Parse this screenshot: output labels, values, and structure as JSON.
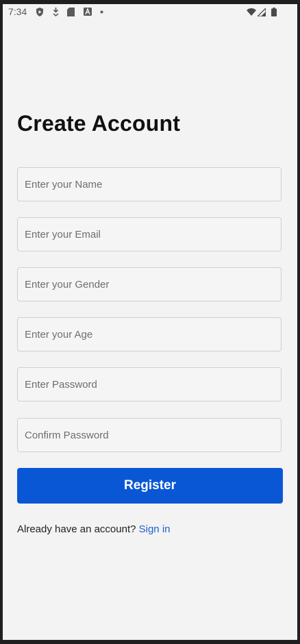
{
  "status_bar": {
    "time": "7:34",
    "left_icons": [
      "play-protect-icon",
      "download-icon",
      "sd-card-icon",
      "a-icon",
      "dot-icon"
    ],
    "right_icons": [
      "wifi-icon",
      "signal-icon",
      "battery-icon"
    ]
  },
  "page": {
    "title": "Create Account"
  },
  "form": {
    "name_placeholder": "Enter your Name",
    "email_placeholder": "Enter your Email",
    "gender_placeholder": "Enter your Gender",
    "age_placeholder": "Enter your Age",
    "password_placeholder": "Enter Password",
    "confirm_placeholder": "Confirm Password",
    "register_label": "Register"
  },
  "footer": {
    "prompt": "Already have an account?",
    "link": "Sign in"
  },
  "colors": {
    "accent": "#0a57d6",
    "link": "#1f5fd1",
    "background": "#f3f3f3"
  }
}
